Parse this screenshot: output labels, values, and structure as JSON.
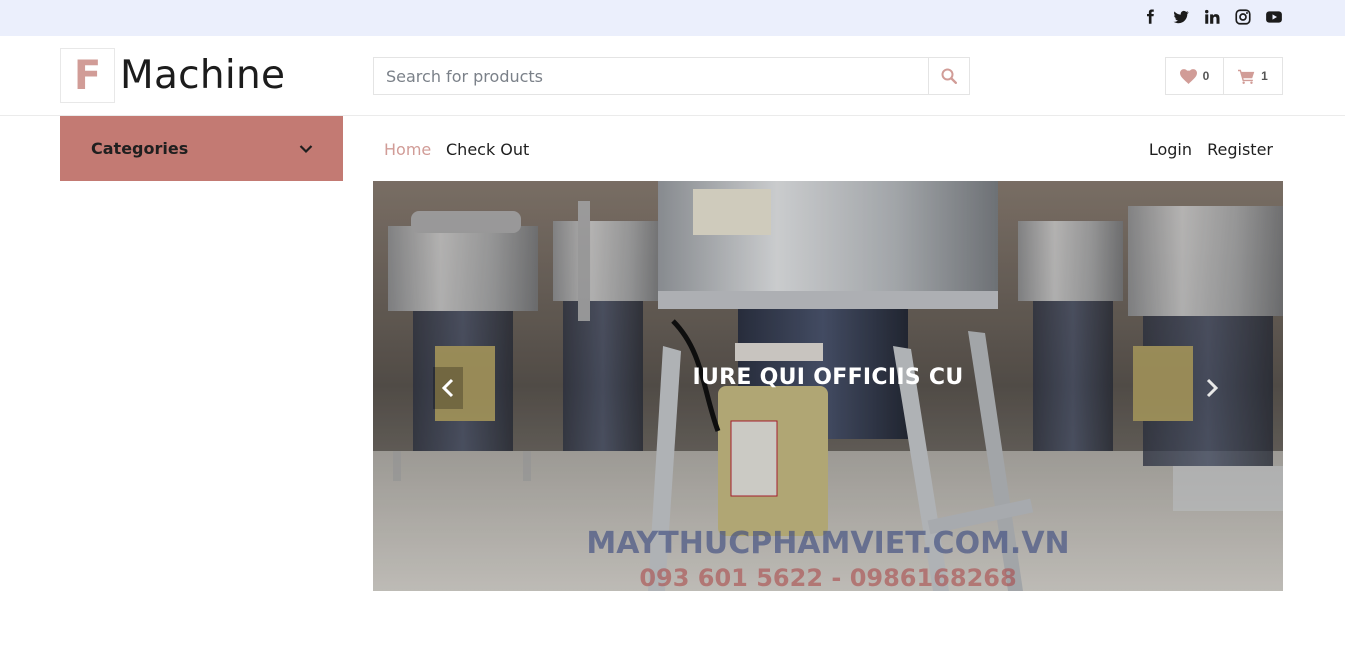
{
  "topbar": {
    "social": [
      "facebook-icon",
      "twitter-icon",
      "linkedin-icon",
      "instagram-icon",
      "youtube-icon"
    ]
  },
  "header": {
    "logo_letter": "F",
    "logo_text": "Machine",
    "search": {
      "placeholder": "Search for products"
    },
    "wishlist_count": "0",
    "cart_count": "1"
  },
  "categories": {
    "label": "Categories"
  },
  "nav": {
    "home": "Home",
    "checkout": "Check Out",
    "login": "Login",
    "register": "Register"
  },
  "carousel": {
    "caption": "IURE QUI OFFICIIS CU"
  },
  "colors": {
    "accent": "#d19c97",
    "category_bg": "#c37a73",
    "topbar_bg": "#ebeffc"
  }
}
